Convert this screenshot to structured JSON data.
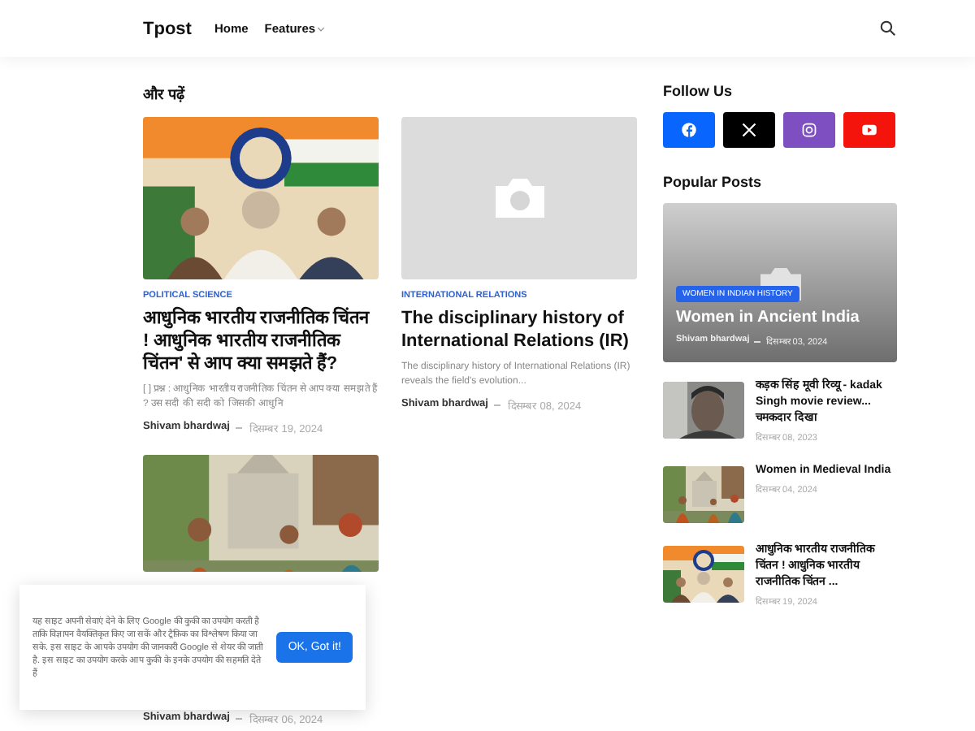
{
  "header": {
    "logo": "Tpost",
    "nav": [
      {
        "label": "Home",
        "has_dropdown": false
      },
      {
        "label": "Features",
        "has_dropdown": true
      }
    ]
  },
  "section_title": "और पढ़ें",
  "posts": [
    {
      "kind": "picture",
      "category": "POLITICAL SCIENCE",
      "title": "आधुनिक भारतीय राजनीतिक चिंतन ! आधुनिक भारतीय राजनीतिक चिंतन' से आप क्या समझते हैं?",
      "snippet": "[ ] प्रश्न : आधुनिक भारतीय राजनीतिक चिंतन से आप क्या समझते हैं ? उस सदी की सदी को जिसकी आधुनि",
      "author": "Shivam bhardwaj",
      "date": "दिसम्बर 19, 2024"
    },
    {
      "kind": "placeholder",
      "category": "INTERNATIONAL RELATIONS",
      "title": "The disciplinary history of International Relations (IR)",
      "snippet": "The disciplinary history of International Relations (IR) reveals the field's evolution...",
      "author": "Shivam bhardwaj",
      "date": "दिसम्बर 08, 2024"
    },
    {
      "kind": "picture",
      "author": "Shivam bhardwaj",
      "date": "दिसम्बर 06, 2024"
    }
  ],
  "sidebar": {
    "follow_title": "Follow Us",
    "socials": [
      {
        "kind": "facebook",
        "color": "#0866ff"
      },
      {
        "kind": "x",
        "color": "#000000"
      },
      {
        "kind": "instagram",
        "color": "#7e4fc0"
      },
      {
        "kind": "youtube",
        "color": "#f5140c"
      }
    ],
    "popular_title": "Popular Posts",
    "featured": {
      "category": "WOMEN IN INDIAN HISTORY",
      "title": "Women in Ancient India",
      "author": "Shivam bhardwaj",
      "date": "दिसम्बर 03, 2024"
    },
    "popular": [
      {
        "title": "कड़क सिंह मूवी रिव्यू - kadak Singh movie review... चमकदार दिखा",
        "date": "दिसम्बर 08, 2023"
      },
      {
        "title": "Women in Medieval India",
        "date": "दिसम्बर 04, 2024"
      },
      {
        "title": "आधुनिक भारतीय राजनीतिक चिंतन ! आधुनिक भारतीय राजनीतिक चिंतन ...",
        "date": "दिसम्बर 19, 2024"
      }
    ]
  },
  "cookie": {
    "text": "यह साइट अपनी सेवाएं देने के लिए Google की कुकी का उपयोग करती है ताकि विज्ञापन वैयक्तिकृत किए जा सकें और ट्रैफ़िक का विश्लेषण किया जा सके. इस साइट के आपके उपयोग की जानकारी Google से शेयर की जाती है. इस साइट का उपयोग करके आप कुकी के इनके उपयोग की सहमति देते हैं",
    "button": "OK, Got it!"
  }
}
